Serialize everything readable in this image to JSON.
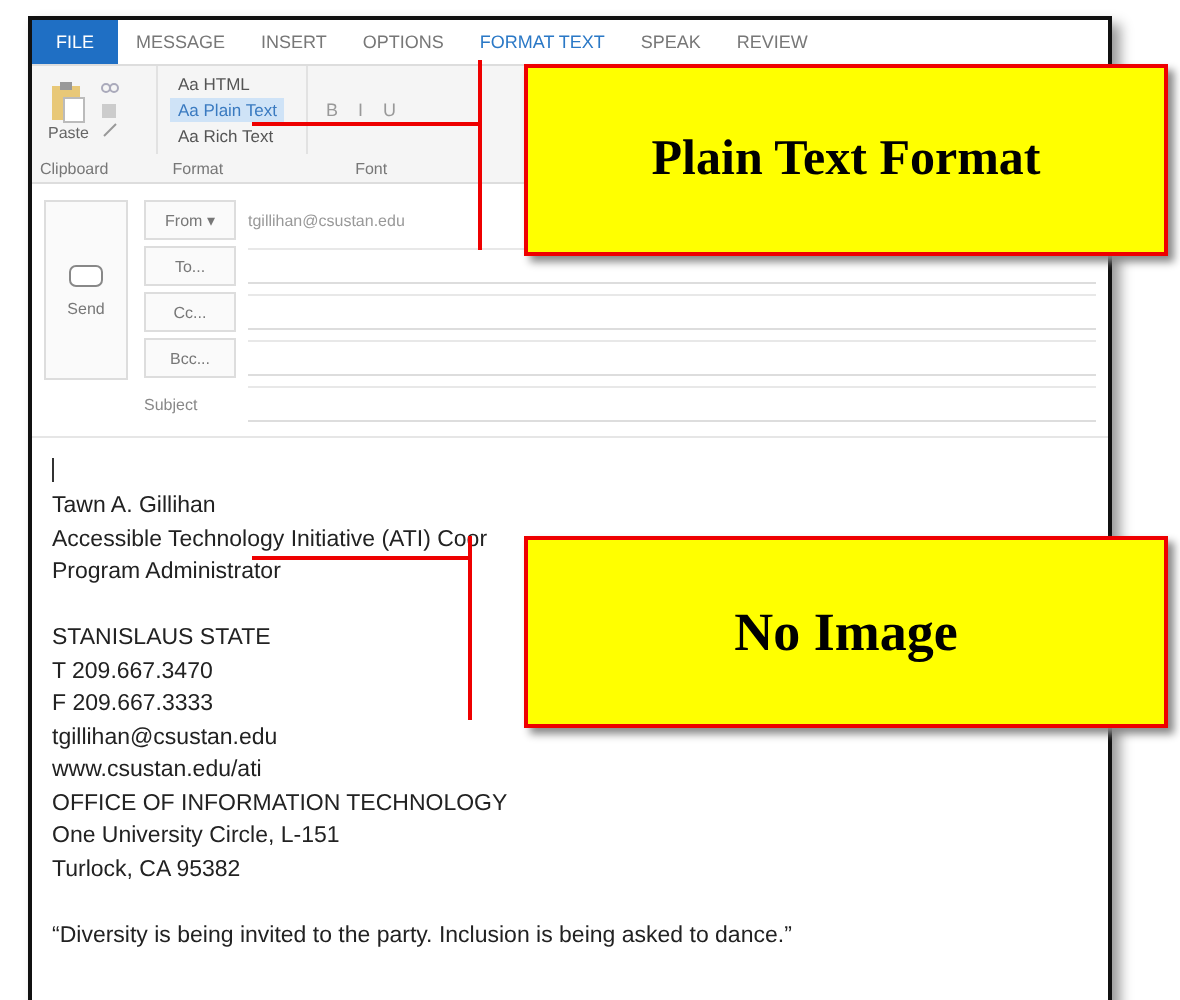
{
  "ribbon": {
    "tabs": [
      {
        "label": "FILE",
        "kind": "file",
        "selected": false
      },
      {
        "label": "MESSAGE",
        "kind": "tab",
        "selected": false
      },
      {
        "label": "INSERT",
        "kind": "tab",
        "selected": false
      },
      {
        "label": "OPTIONS",
        "kind": "tab",
        "selected": false
      },
      {
        "label": "FORMAT TEXT",
        "kind": "tab",
        "selected": true
      },
      {
        "label": "SPEAK",
        "kind": "tab",
        "selected": false
      },
      {
        "label": "REVIEW",
        "kind": "tab",
        "selected": false
      }
    ],
    "paste": "Paste",
    "formats": [
      {
        "label": "Aa HTML",
        "selected": false
      },
      {
        "label": "Aa Plain Text",
        "selected": true
      },
      {
        "label": "Aa Rich Text",
        "selected": false
      }
    ],
    "font_buttons": [
      "B",
      "I",
      "U"
    ],
    "group_labels": [
      "Clipboard",
      "Format",
      "Font"
    ]
  },
  "header": {
    "send": "Send",
    "from": {
      "label": "From ▾",
      "value": "tgillihan@csustan.edu"
    },
    "fields": [
      {
        "label": "To...",
        "kind": "button"
      },
      {
        "label": "Cc...",
        "kind": "button"
      },
      {
        "label": "Bcc...",
        "kind": "button"
      },
      {
        "label": "Subject",
        "kind": "label"
      }
    ]
  },
  "body": {
    "paragraphs": [
      [
        "Tawn A. Gillihan",
        "Accessible Technology Initiative (ATI) Coor",
        "Program Administrator"
      ],
      [
        "STANISLAUS STATE",
        "T 209.667.3470",
        "F 209.667.3333",
        "tgillihan@csustan.edu",
        "www.csustan.edu/ati",
        "OFFICE OF INFORMATION TECHNOLOGY",
        "One University Circle, L-151",
        "Turlock, CA 95382"
      ],
      [
        "“Diversity is being invited to the party. Inclusion is being asked to dance.”"
      ]
    ]
  },
  "callouts": [
    "Plain Text Format",
    "No Image"
  ]
}
